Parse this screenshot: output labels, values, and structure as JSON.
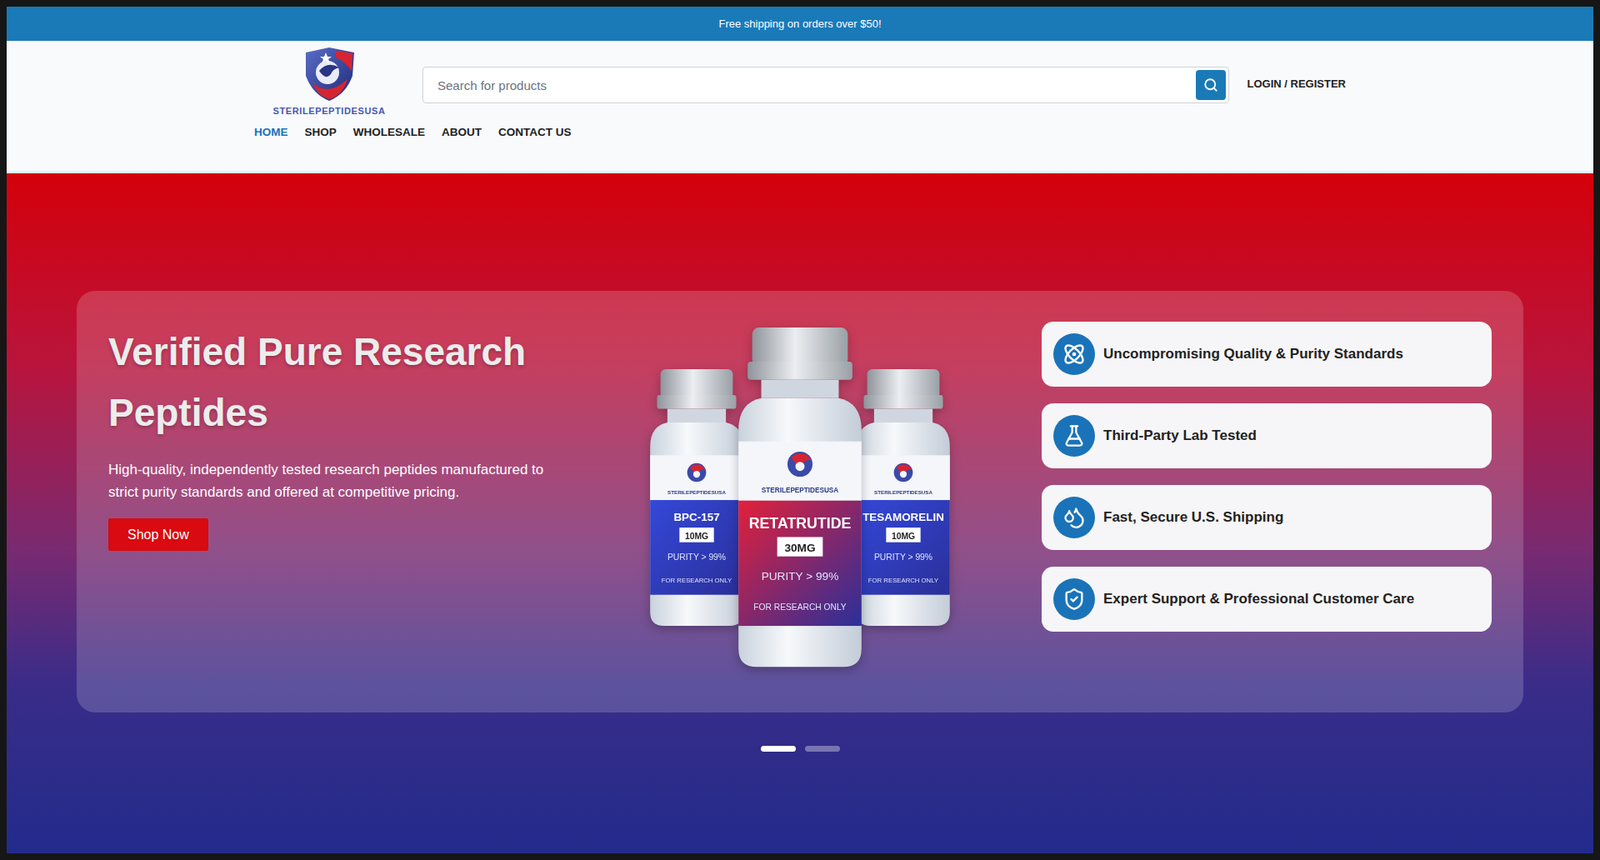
{
  "announcement": "Free shipping on orders over $50!",
  "logo": {
    "text": "STERILEPEPTIDESUSA"
  },
  "search": {
    "placeholder": "Search for products"
  },
  "account": "LOGIN / REGISTER",
  "nav": [
    {
      "label": "HOME",
      "selected": true
    },
    {
      "label": "SHOP",
      "selected": false
    },
    {
      "label": "WHOLESALE",
      "selected": false
    },
    {
      "label": "ABOUT",
      "selected": false
    },
    {
      "label": "CONTACT US",
      "selected": false
    }
  ],
  "hero": {
    "title": "Verified Pure Research Peptides",
    "description": "High-quality, independently tested research peptides manufactured to strict purity standards and offered at competitive pricing.",
    "button": "Shop Now",
    "vials": [
      {
        "brand": "STERILEPEPTIDESUSA",
        "name": "BPC-157",
        "dose": "10MG",
        "purity": "PURITY > 99%",
        "note": "FOR RESEARCH ONLY",
        "color": "#3448d8"
      },
      {
        "brand": "STERILEPEPTIDESUSA",
        "name": "RETATRUTIDE",
        "dose": "30MG",
        "purity": "PURITY > 99%",
        "note": "FOR RESEARCH ONLY",
        "color": "#e3203a"
      },
      {
        "brand": "STERILEPEPTIDESUSA",
        "name": "TESAMORELIN",
        "dose": "10MG",
        "purity": "PURITY > 99%",
        "note": "FOR RESEARCH ONLY",
        "color": "#3448d8"
      }
    ],
    "features": [
      "Uncompromising Quality & Purity Standards",
      "Third-Party Lab Tested",
      "Fast, Secure U.S. Shipping",
      "Expert Support & Professional Customer Care"
    ]
  },
  "slides": [
    {
      "selected": true
    },
    {
      "selected": false
    }
  ]
}
